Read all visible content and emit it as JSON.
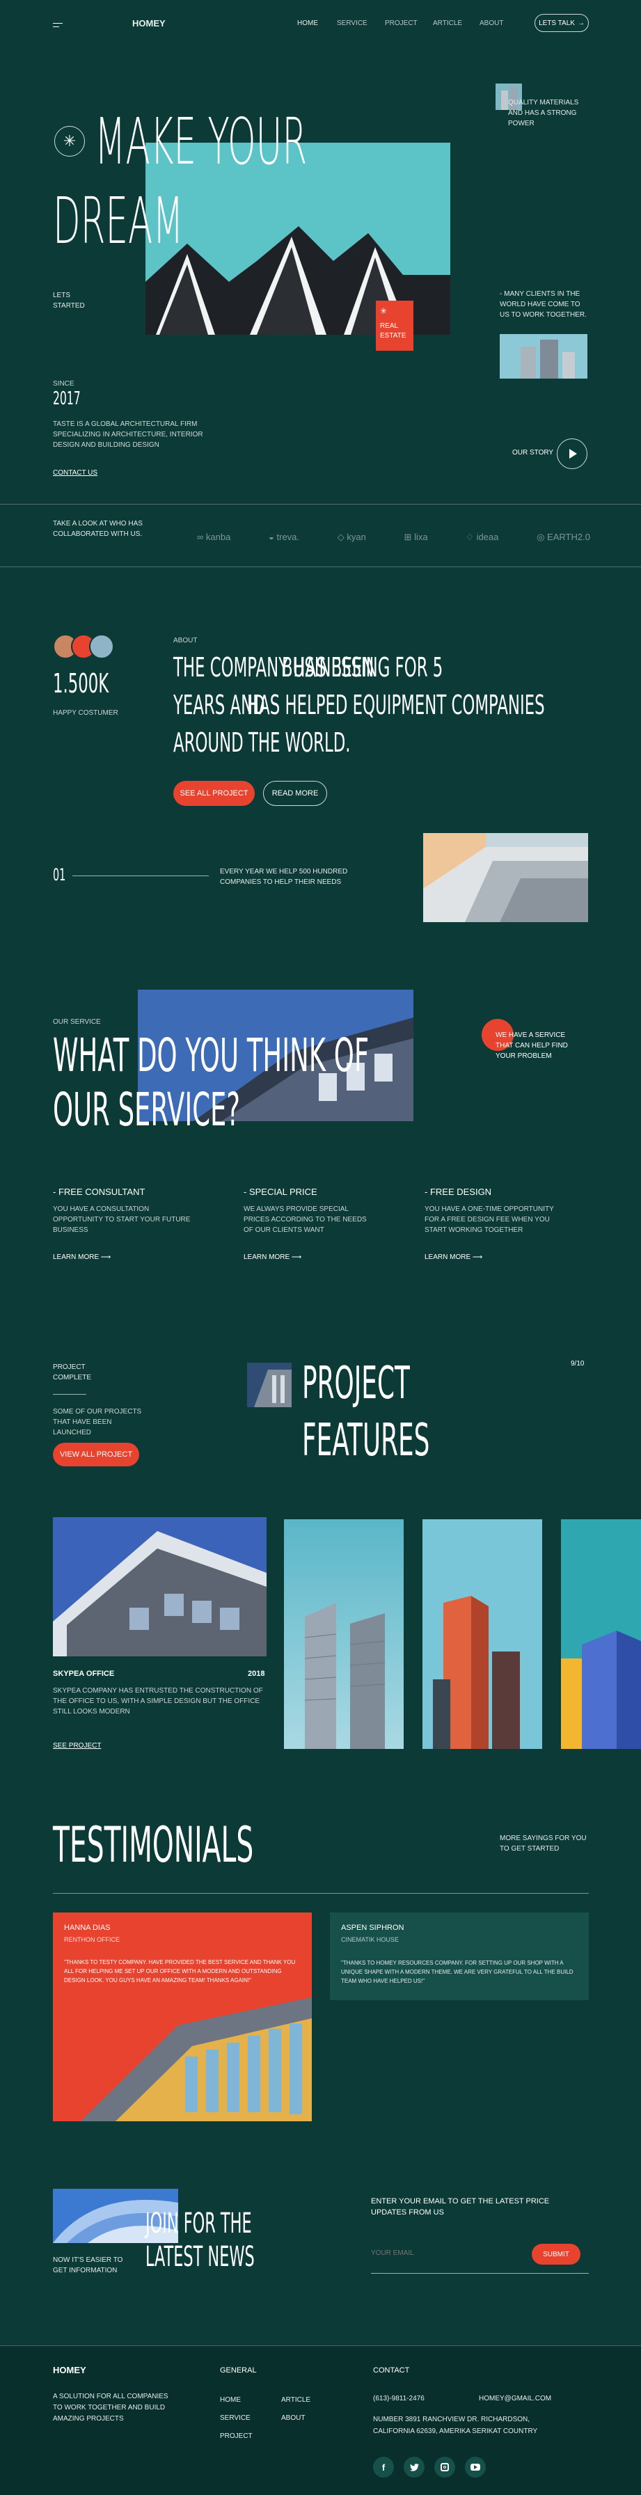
{
  "brand": "HOMEY",
  "nav": {
    "items": [
      "HOME",
      "SERVICE",
      "PROJECT",
      "ARTICLE",
      "ABOUT"
    ],
    "cta": "LETS TALK"
  },
  "hero": {
    "title_line1": "MAKE YOUR",
    "title_line2": "DREAM",
    "lets_started": "LETS STARTED",
    "badge": "REAL ESTATE",
    "quality": "QUALITY MATERIALS AND HAS A STRONG POWER",
    "clients": "- MANY CLIENTS IN THE WORLD HAVE COME TO US TO WORK TOGETHER.",
    "since_label": "SINCE",
    "since_year": "2017",
    "description": "TASTE IS A GLOBAL ARCHITECTURAL FIRM SPECIALIZING IN ARCHITECTURE, INTERIOR DESIGN AND BUILDING DESIGN",
    "contact_link": "CONTACT US",
    "our_story": "OUR STORY"
  },
  "partners": {
    "label": "TAKE A LOOK AT WHO HAS COLLABORATED WITH US.",
    "logos": [
      "kanba",
      "treva.",
      "kyan",
      "lixa",
      "ideaa",
      "EARTH2.0"
    ]
  },
  "about": {
    "count": "1.500K",
    "count_label": "HAPPY COSTUMER",
    "label": "ABOUT",
    "text_part1": "THE COMPANY HAS BEEN",
    "text_part2": "BUSINESSING FOR 5",
    "text_part3": "YEARS AND",
    "text_part4": "HAS HELPED EQUIPMENT COMPANIES",
    "text_part5": "AROUND THE WORLD.",
    "btn_projects": "SEE ALL PROJECT",
    "btn_more": "READ MORE",
    "index": "01",
    "help_text": "EVERY YEAR WE HELP 500 HUNDRED COMPANIES TO HELP THEIR NEEDS"
  },
  "service": {
    "label": "OUR SERVICE",
    "title_line1": "WHAT DO YOU THINK OF",
    "title_line2": "OUR SERVICE?",
    "side_text": "WE HAVE A SERVICE THAT CAN HELP FIND YOUR PROBLEM",
    "items": [
      {
        "title": "- FREE CONSULTANT",
        "desc": "YOU HAVE A CONSULTATION OPPORTUNITY TO START YOUR FUTURE BUSINESS",
        "link": "LEARN MORE"
      },
      {
        "title": "- SPECIAL PRICE",
        "desc": "WE ALWAYS PROVIDE SPECIAL PRICES ACCORDING TO THE NEEDS OF OUR CLIENTS WANT",
        "link": "LEARN MORE"
      },
      {
        "title": "- FREE DESIGN",
        "desc": "YOU HAVE A ONE-TIME OPPORTUNITY FOR A FREE DESIGN FEE WHEN YOU START WORKING TOGETHER",
        "link": "LEARN MORE"
      }
    ]
  },
  "projects": {
    "complete": "PROJECT COMPLETE",
    "launched": "SOME OF OUR PROJECTS THAT HAVE BEEN LAUNCHED",
    "btn": "VIEW ALL PROJECT",
    "title_line1": "PROJECT",
    "title_line2": "FEATURES",
    "counter": "9/10",
    "featured_name": "SKYPEA OFFICE",
    "featured_year": "2018",
    "featured_desc": "SKYPEA COMPANY HAS ENTRUSTED THE CONSTRUCTION OF THE OFFICE TO US, WITH A SIMPLE DESIGN BUT THE OFFICE STILL LOOKS MODERN",
    "featured_link": "SEE PROJECT"
  },
  "testimonials": {
    "title": "TESTIMONIALS",
    "more": "MORE SAYINGS FOR YOU TO GET STARTED",
    "cards": [
      {
        "name": "HANNA DIAS",
        "company": "RENTHON OFFICE",
        "quote": "\"THANKS TO TESTY COMPANY. HAVE PROVIDED THE BEST SERVICE AND THANK YOU ALL FOR HELPING ME SET UP OUR OFFICE WITH A MODERN AND OUTSTANDING DESIGN LOOK. YOU GUYS HAVE AN AMAZING TEAM! THANKS AGAIN!\""
      },
      {
        "name": "ASPEN SIPHRON",
        "company": "CINEMATIK HOUSE",
        "quote": "\"THANKS TO HOMEY RESOURCES COMPANY. FOR SETTING UP OUR SHOP WITH A UNIQUE SHAPE WITH A MODERN THEME. WE ARE VERY GRATEFUL TO ALL THE BUILD TEAM WHO HAVE HELPED US!\""
      }
    ]
  },
  "newsletter": {
    "side": "NOW IT'S EASIER TO GET INFORMATION",
    "title_line1": "JOIN FOR THE",
    "title_line2": "LATEST NEWS",
    "prompt": "ENTER YOUR EMAIL TO GET THE LATEST PRICE UPDATES FROM US",
    "placeholder": "YOUR EMAIL",
    "submit": "SUBMIT"
  },
  "footer": {
    "brand": "HOMEY",
    "tagline": "A SOLUTION FOR ALL COMPANIES TO WORK TOGETHER AND BUILD AMAZING PROJECTS",
    "general_title": "GENERAL",
    "general_col1": [
      "HOME",
      "SERVICE",
      "PROJECT"
    ],
    "general_col2": [
      "ARTICLE",
      "ABOUT"
    ],
    "contact_title": "CONTACT",
    "phone": "(613)-9811-2476",
    "email": "HOMEY@GMAIL.COM",
    "address": "NUMBER 3891 RANCHVIEW DR. RICHARDSON, CALIFORNIA 62639, AMERIKA SERIKAT COUNTRY",
    "socials": [
      "facebook-icon",
      "twitter-icon",
      "instagram-icon",
      "youtube-icon"
    ]
  },
  "colors": {
    "background": "#0c3a36",
    "accent": "#e8432e",
    "teal": "#5bc2c6"
  }
}
